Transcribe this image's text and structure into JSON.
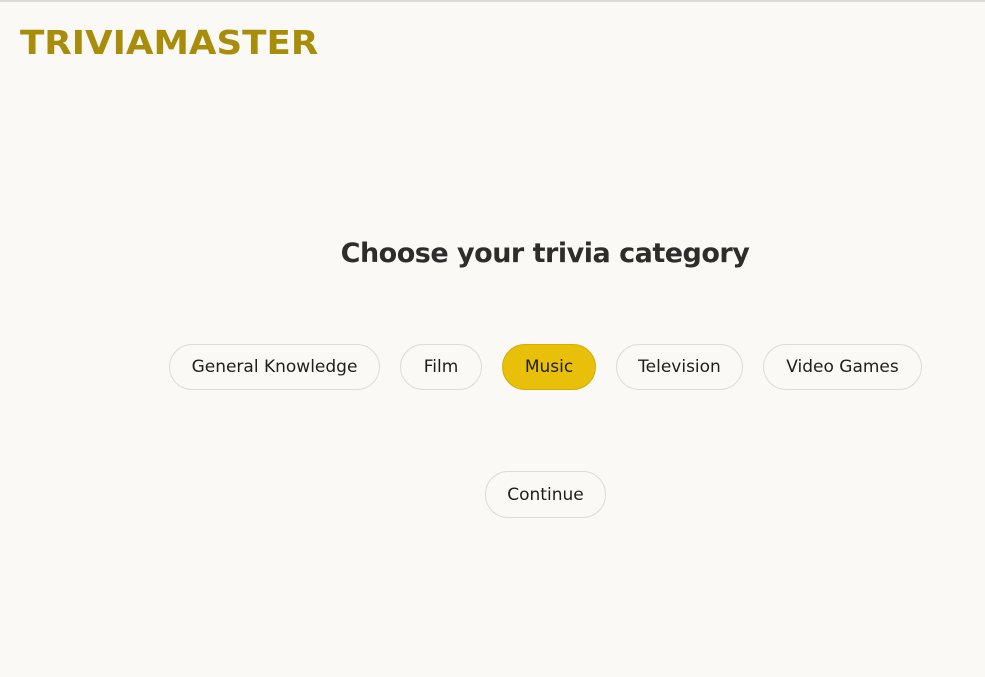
{
  "app": {
    "logo_text": "TRIVIAMASTER",
    "brand_color": "#a88d0b"
  },
  "main": {
    "title": "Choose your trivia category",
    "categories": [
      {
        "label": "General Knowledge",
        "selected": false
      },
      {
        "label": "Film",
        "selected": false
      },
      {
        "label": "Music",
        "selected": true
      },
      {
        "label": "Television",
        "selected": false
      },
      {
        "label": "Video Games",
        "selected": false
      }
    ],
    "selected_color": "#e8c00a",
    "continue_label": "Continue"
  }
}
